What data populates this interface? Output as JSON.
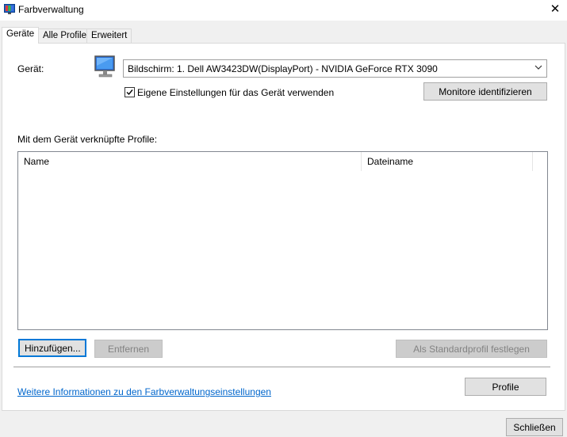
{
  "window": {
    "title": "Farbverwaltung",
    "close_glyph": "✕"
  },
  "tabs": [
    {
      "label": "Geräte",
      "active": true
    },
    {
      "label": "Alle Profile",
      "active": false
    },
    {
      "label": "Erweitert",
      "active": false
    }
  ],
  "device": {
    "label": "Gerät:",
    "selected": "Bildschirm: 1. Dell AW3423DW(DisplayPort) - NVIDIA GeForce RTX 3090",
    "use_own_settings_label": "Eigene Einstellungen für das Gerät verwenden",
    "use_own_settings_checked": true,
    "identify_button": "Monitore identifizieren"
  },
  "profiles": {
    "section_label": "Mit dem Gerät verknüpfte Profile:",
    "columns": [
      "Name",
      "Dateiname"
    ],
    "rows": [],
    "add_button": "Hinzufügen...",
    "remove_button": "Entfernen",
    "set_default_button": "Als Standardprofil festlegen"
  },
  "footer": {
    "info_link": "Weitere Informationen zu den Farbverwaltungseinstellungen",
    "profile_button": "Profile",
    "close_button": "Schließen"
  },
  "colors": {
    "accent": "#0078d7",
    "link": "#0066cc"
  }
}
